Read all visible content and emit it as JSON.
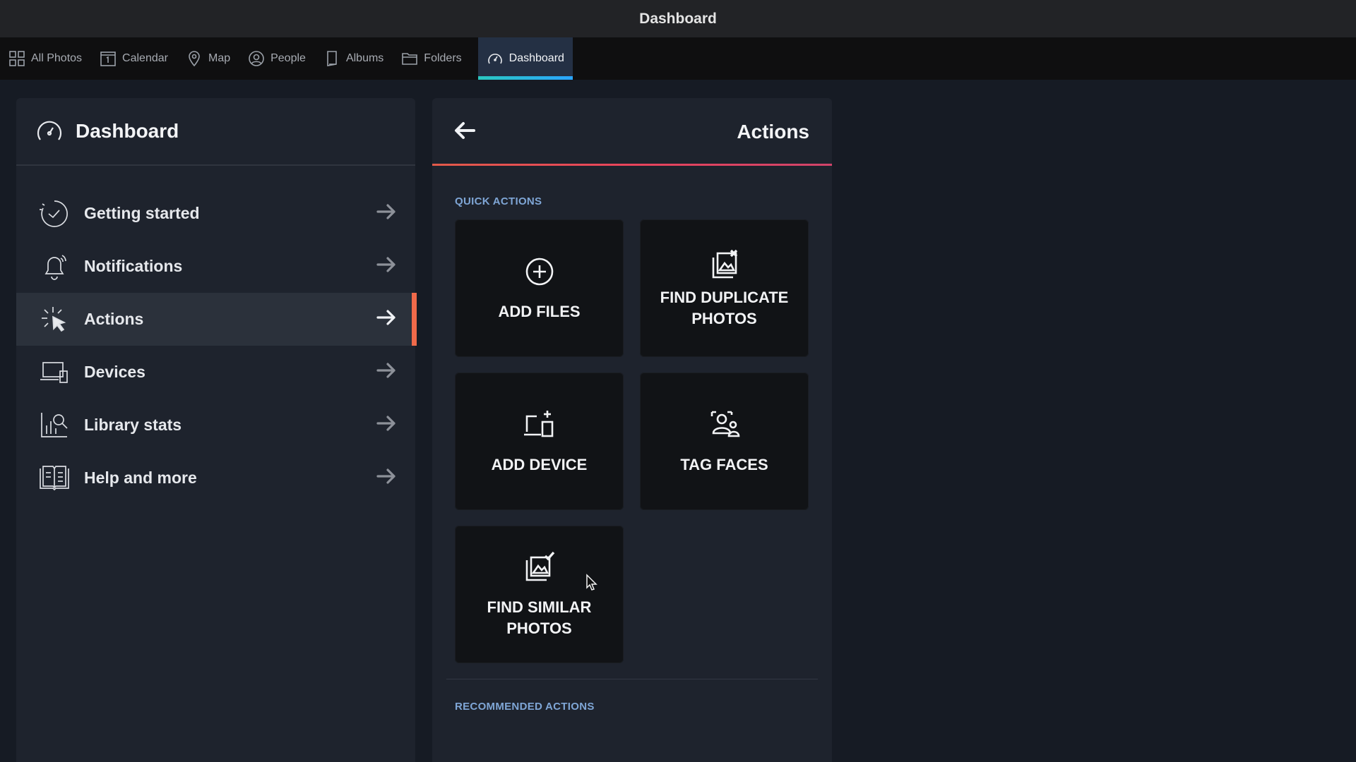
{
  "window": {
    "title": "Dashboard"
  },
  "tabs": [
    {
      "label": "All Photos",
      "icon": "grid-icon"
    },
    {
      "label": "Calendar",
      "icon": "calendar-icon"
    },
    {
      "label": "Map",
      "icon": "map-pin-icon"
    },
    {
      "label": "People",
      "icon": "person-icon"
    },
    {
      "label": "Albums",
      "icon": "album-icon"
    },
    {
      "label": "Folders",
      "icon": "folder-icon"
    },
    {
      "label": "Dashboard",
      "icon": "gauge-icon",
      "active": true
    }
  ],
  "sidebar": {
    "title": "Dashboard",
    "items": [
      {
        "label": "Getting started",
        "icon": "check-circle-icon"
      },
      {
        "label": "Notifications",
        "icon": "bell-icon"
      },
      {
        "label": "Actions",
        "icon": "click-icon",
        "active": true
      },
      {
        "label": "Devices",
        "icon": "devices-icon"
      },
      {
        "label": "Library stats",
        "icon": "stats-icon"
      },
      {
        "label": "Help and more",
        "icon": "book-icon"
      }
    ]
  },
  "main": {
    "title": "Actions",
    "quick_actions_label": "QUICK ACTIONS",
    "quick_actions": [
      {
        "label": "ADD FILES",
        "icon": "plus-circle-icon"
      },
      {
        "label": "FIND DUPLICATE PHOTOS",
        "icon": "duplicate-photos-icon"
      },
      {
        "label": "ADD DEVICE",
        "icon": "add-device-icon"
      },
      {
        "label": "TAG FACES",
        "icon": "tag-faces-icon"
      },
      {
        "label": "FIND SIMILAR PHOTOS",
        "icon": "similar-photos-icon"
      }
    ],
    "recommended_label": "RECOMMENDED ACTIONS"
  },
  "colors": {
    "accent_active_tab": "#2aa5ff",
    "accent_sidebar": "#f06a4a",
    "section_label": "#7fa6d6"
  }
}
